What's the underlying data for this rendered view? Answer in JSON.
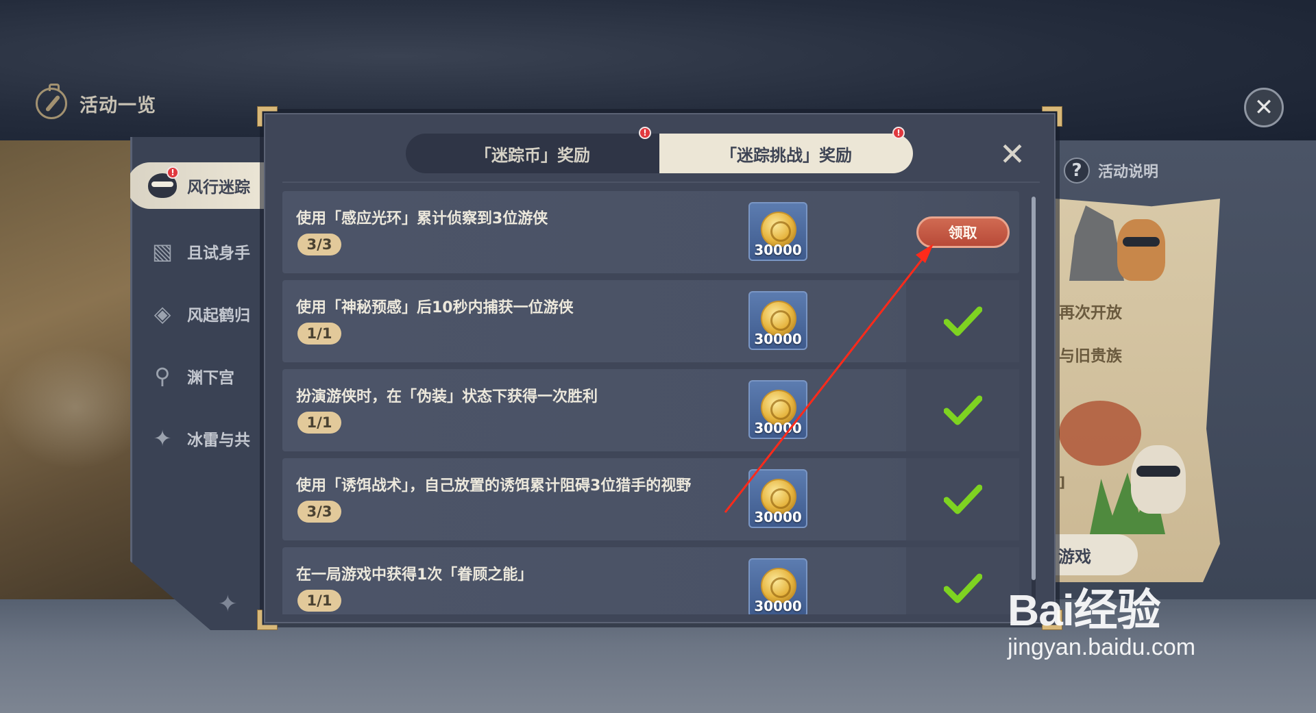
{
  "page": {
    "title": "活动一览"
  },
  "side_nav": {
    "items": [
      {
        "label": "风行迷踪",
        "icon": "masked-cat-icon",
        "active": true,
        "alert": "!"
      },
      {
        "label": "且试身手",
        "icon": "cards-icon",
        "active": false
      },
      {
        "label": "风起鹤归",
        "icon": "crane-emblem-icon",
        "active": false
      },
      {
        "label": "渊下宫",
        "icon": "location-pin-icon",
        "active": false
      },
      {
        "label": "冰雷与共",
        "icon": "crystal-icon",
        "active": false
      }
    ]
  },
  "right_panel": {
    "help_label": "活动说明",
    "line_1": "再次开放",
    "line_2": "与旧贵族",
    "line_3": "]",
    "play_label": "游戏"
  },
  "modal": {
    "tabs": [
      {
        "label": "「迷踪币」奖励",
        "active": false,
        "alert": "!"
      },
      {
        "label": "「迷踪挑战」奖励",
        "active": true,
        "alert": "!"
      }
    ],
    "close_icon": "close-x-icon",
    "tasks": [
      {
        "description": "使用「感应光环」累计侦察到3位游侠",
        "progress": "3/3",
        "reward_amount": "30000",
        "state": "claimable",
        "claim_label": "领取"
      },
      {
        "description": "使用「神秘预感」后10秒内捕获一位游侠",
        "progress": "1/1",
        "reward_amount": "30000",
        "state": "claimed"
      },
      {
        "description": "扮演游侠时，在「伪装」状态下获得一次胜利",
        "progress": "1/1",
        "reward_amount": "30000",
        "state": "claimed"
      },
      {
        "description": "使用「诱饵战术」，自己放置的诱饵累计阻碍3位猎手的视野",
        "progress": "3/3",
        "reward_amount": "30000",
        "state": "claimed"
      },
      {
        "description": "在一局游戏中获得1次「眷顾之能」",
        "progress": "1/1",
        "reward_amount": "30000",
        "state": "claimed"
      }
    ]
  },
  "watermark": {
    "brand": "Bai经验",
    "url": "jingyan.baidu.com"
  },
  "colors": {
    "claim_button": "#c4573f",
    "check": "#7ed321",
    "progress_pill": "#e2c99a",
    "modal_bg": "#3f4658",
    "annotation_arrow": "#ff2a1a"
  }
}
